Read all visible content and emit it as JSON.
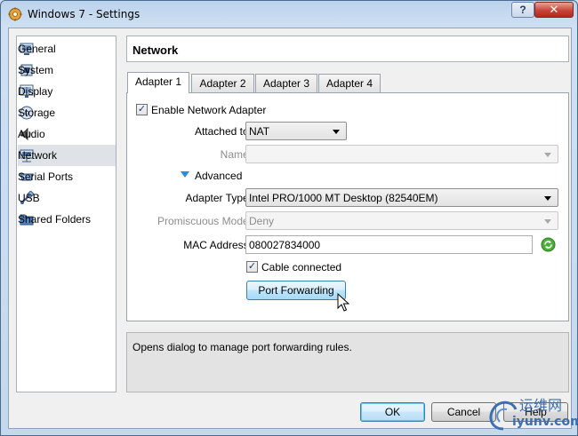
{
  "window": {
    "title": "Windows 7 - Settings",
    "help_label": "?",
    "close_label": "✕"
  },
  "sidebar": {
    "items": [
      {
        "label": "General",
        "icon": "general-icon"
      },
      {
        "label": "System",
        "icon": "system-icon"
      },
      {
        "label": "Display",
        "icon": "display-icon"
      },
      {
        "label": "Storage",
        "icon": "storage-icon"
      },
      {
        "label": "Audio",
        "icon": "audio-icon"
      },
      {
        "label": "Network",
        "icon": "network-icon",
        "selected": true
      },
      {
        "label": "Serial Ports",
        "icon": "serial-ports-icon"
      },
      {
        "label": "USB",
        "icon": "usb-icon"
      },
      {
        "label": "Shared Folders",
        "icon": "shared-folders-icon"
      }
    ]
  },
  "header": {
    "title": "Network"
  },
  "tabs": [
    {
      "label": "Adapter 1",
      "active": true
    },
    {
      "label": "Adapter 2"
    },
    {
      "label": "Adapter 3"
    },
    {
      "label": "Adapter 4"
    }
  ],
  "adapter": {
    "enable_label": "Enable Network Adapter",
    "enabled": true,
    "attached_to_label": "Attached to:",
    "attached_to_value": "NAT",
    "name_label": "Name:",
    "name_value": "",
    "advanced_label": "Advanced",
    "adapter_type_label": "Adapter Type:",
    "adapter_type_value": "Intel PRO/1000 MT Desktop (82540EM)",
    "promiscuous_label": "Promiscuous Mode:",
    "promiscuous_value": "Deny",
    "mac_label": "MAC Address:",
    "mac_value": "080027834000",
    "cable_label": "Cable connected",
    "cable_connected": true,
    "port_forwarding_label": "Port Forwarding"
  },
  "info": {
    "text": "Opens dialog to manage port forwarding rules."
  },
  "footer": {
    "ok_label": "OK",
    "cancel_label": "Cancel",
    "help_label": "Help"
  },
  "watermark": {
    "line1": "运维网",
    "line2": "iyunv.com"
  },
  "colors": {
    "accent": "#3c7fb1",
    "selected_bg": "#dfe3e8",
    "close_red": "#c7453a"
  }
}
